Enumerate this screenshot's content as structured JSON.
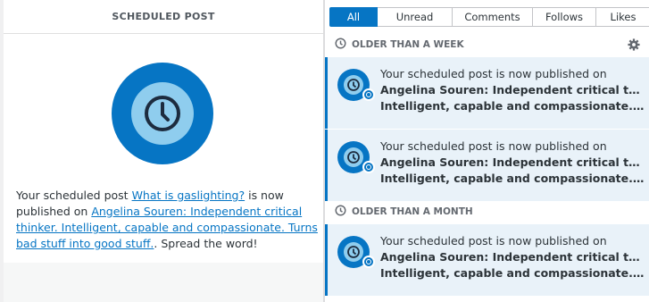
{
  "left": {
    "header": "SCHEDULED POST",
    "message": {
      "pre": "Your scheduled post ",
      "post_link": "What is gaslighting?",
      "mid": " is now published on ",
      "site_link": "Angelina Souren: Independent critical thinker. Intelligent, capable and compassionate. Turns bad stuff into good stuff.",
      "post": ". Spread the word!"
    }
  },
  "tabs": [
    "All",
    "Unread",
    "Comments",
    "Follows",
    "Likes"
  ],
  "active_tab": "All",
  "sections": {
    "week": "OLDER THAN A WEEK",
    "month": "OLDER THAN A MONTH"
  },
  "notifications": [
    {
      "text": "Your scheduled post is now published on",
      "line1": "Angelina Souren: Independent critical thinker.",
      "line2": "Intelligent, capable and compassionate. Turns bad stuff into good stuff."
    },
    {
      "text": "Your scheduled post is now published on",
      "line1": "Angelina Souren: Independent critical thinker.",
      "line2": "Intelligent, capable and compassionate. Turns bad stuff into good stuff."
    },
    {
      "text": "Your scheduled post is now published on",
      "line1": "Angelina Souren: Independent critical thinker.",
      "line2": "Intelligent, capable and compassionate. Turns bad stuff into good stuff."
    }
  ],
  "icons": {
    "section": "clock-icon",
    "settings": "gear-icon",
    "badge": "clock-badge-icon"
  },
  "colors": {
    "accent": "#0675c4",
    "light_accent": "#8fcdee",
    "unread_bg": "#e9f2f9"
  }
}
